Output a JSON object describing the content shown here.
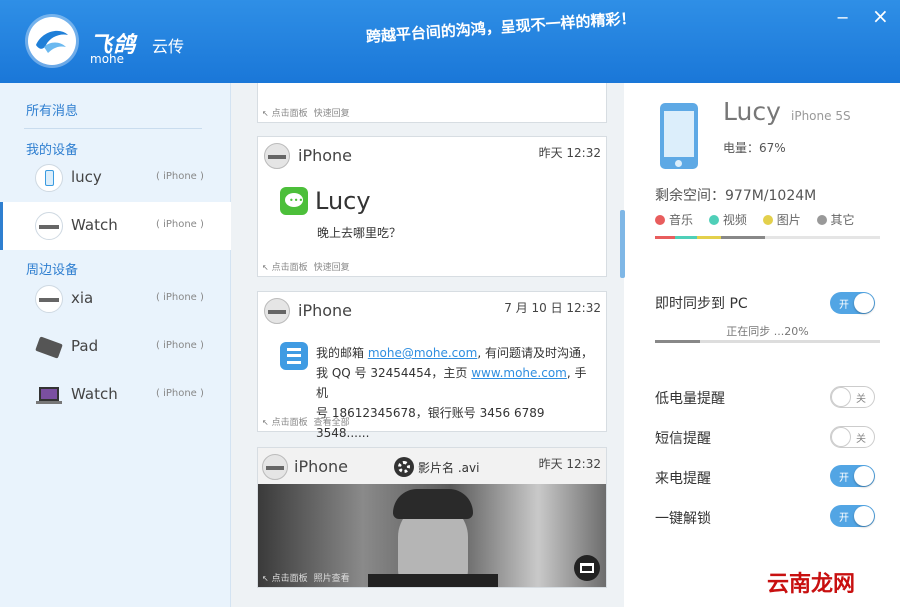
{
  "header": {
    "brand_title": "飞鸽",
    "brand_sub": "云传",
    "brand_en": "mohe",
    "slogan": "跨越平台间的沟鸿，呈现不一样的精彩！",
    "minimize": "−",
    "close": "×"
  },
  "sidebar": {
    "all_messages": "所有消息",
    "my_devices_title": "我的设备",
    "nearby_title": "周边设备",
    "my_devices": [
      {
        "name": "lucy",
        "type": "( iPhone )"
      },
      {
        "name": "Watch",
        "type": "( iPhone )"
      }
    ],
    "nearby_devices": [
      {
        "name": "xia",
        "type": "( iPhone )"
      },
      {
        "name": "Pad",
        "type": "( iPhone )"
      },
      {
        "name": "Watch",
        "type": "( iPhone )"
      }
    ]
  },
  "feed": {
    "cards": [
      {
        "foot_a": "点击面板",
        "foot_b": "快速回复"
      },
      {
        "sender": "iPhone",
        "time": "昨天  12:32",
        "app_name": "Lucy",
        "text": "晚上去哪里吃？",
        "foot_a": "点击面板",
        "foot_b": "快速回复"
      },
      {
        "sender": "iPhone",
        "time": "7 月 10 日  12:32",
        "t1": "我的邮箱 ",
        "email": "mohe@mohe.com",
        "t2": ", 有问题请及时沟通，",
        "t3": "我 QQ 号 32454454，主页 ",
        "url": "www.mohe.com",
        "t4": ", 手机",
        "t5": "号 18612345678，银行账号 3456 6789 3548......",
        "foot_a": "点击面板",
        "foot_b": "查看全部"
      },
      {
        "sender": "iPhone",
        "time": "昨天  12:32",
        "file_name": "影片名 .avi",
        "foot_a": "点击面板",
        "foot_b": "照片查看"
      }
    ]
  },
  "detail": {
    "name": "Lucy",
    "model": "iPhone 5S",
    "battery": "电量：67%",
    "space": "剩余空间：977M/1024M",
    "legend": [
      {
        "label": "音乐",
        "color": "#e85d5d"
      },
      {
        "label": "视频",
        "color": "#4fcfb8"
      },
      {
        "label": "图片",
        "color": "#e3d04c"
      },
      {
        "label": "其它",
        "color": "#999999"
      }
    ],
    "settings": [
      {
        "label": "即时同步到 PC",
        "state": "开",
        "on": true
      },
      {
        "label": "低电量提醒",
        "state": "关",
        "on": false
      },
      {
        "label": "短信提醒",
        "state": "关",
        "on": false
      },
      {
        "label": "来电提醒",
        "state": "开",
        "on": true
      },
      {
        "label": "一键解锁",
        "state": "开",
        "on": true
      }
    ],
    "sync_status": "正在同步 ...20%",
    "sync_progress": 0.2
  },
  "watermark": "云南龙网"
}
